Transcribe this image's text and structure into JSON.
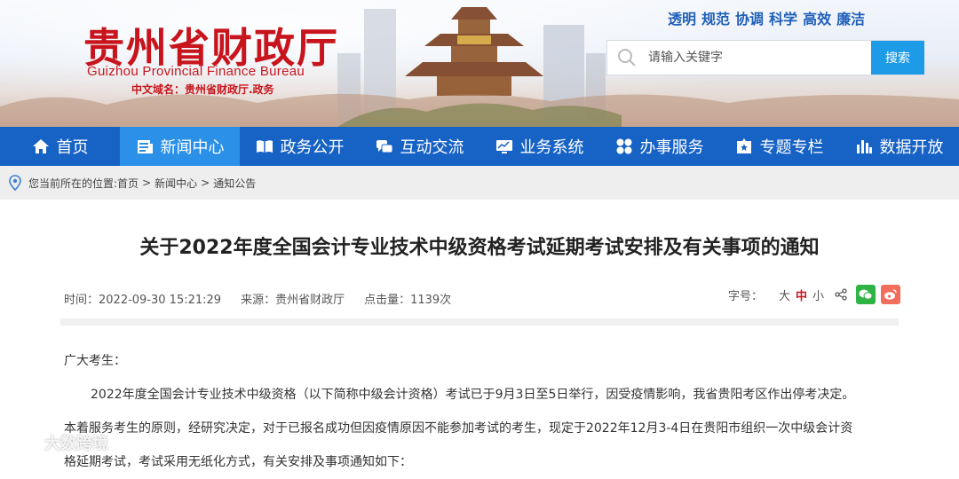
{
  "header": {
    "title_cn": "贵州省财政厅",
    "title_en": "Guizhou Provincial Finance Bureau",
    "domain_line": "中文域名：贵州省财政厅.政务",
    "values": [
      "透明",
      "规范",
      "协调",
      "科学",
      "高效",
      "廉洁"
    ],
    "search": {
      "placeholder": "请输入关键字",
      "button": "搜索"
    }
  },
  "nav": {
    "items": [
      {
        "label": "首页",
        "icon": "home-icon"
      },
      {
        "label": "新闻中心",
        "icon": "news-icon",
        "active": true
      },
      {
        "label": "政务公开",
        "icon": "book-icon"
      },
      {
        "label": "互动交流",
        "icon": "chat-icon"
      },
      {
        "label": "业务系统",
        "icon": "monitor-icon"
      },
      {
        "label": "办事服务",
        "icon": "grid-icon"
      },
      {
        "label": "专题专栏",
        "icon": "star-icon"
      },
      {
        "label": "数据开放",
        "icon": "chart-icon"
      }
    ]
  },
  "breadcrumb": {
    "prefix": "您当前所在的位置:",
    "items": [
      "首页",
      "新闻中心",
      "通知公告"
    ],
    "sep": ">"
  },
  "article": {
    "title": "关于2022年度全国会计专业技术中级资格考试延期考试安排及有关事项的通知",
    "time": "时间：2022-09-30 15:21:29",
    "source": "来源：贵州省财政厅",
    "hits": "点击量：1139次",
    "font_label": "字号：",
    "font_sizes": [
      "大",
      "中",
      "小"
    ],
    "salutation": "广大考生：",
    "para1": "2022年度全国会计专业技术中级资格（以下简称中级会计资格）考试已于9月3日至5日举行，因受疫情影响，我省贵阳考区作出停考决定。",
    "para2a": "本着服务考生的原则，经研究决定，对于已报名成功但因疫情原因不能参加考试的考生，现定于2022年12月3-4日在贵阳市组织一次中级会计资",
    "para2b": "格延期考试，考试采用无纸化方式，有关安排及事项通知如下："
  },
  "watermark": "大数跨境",
  "colors": {
    "brand_red": "#c8151d",
    "nav_blue": "#1762c5",
    "nav_active": "#2a90e8",
    "search_button": "#1e9be6"
  }
}
